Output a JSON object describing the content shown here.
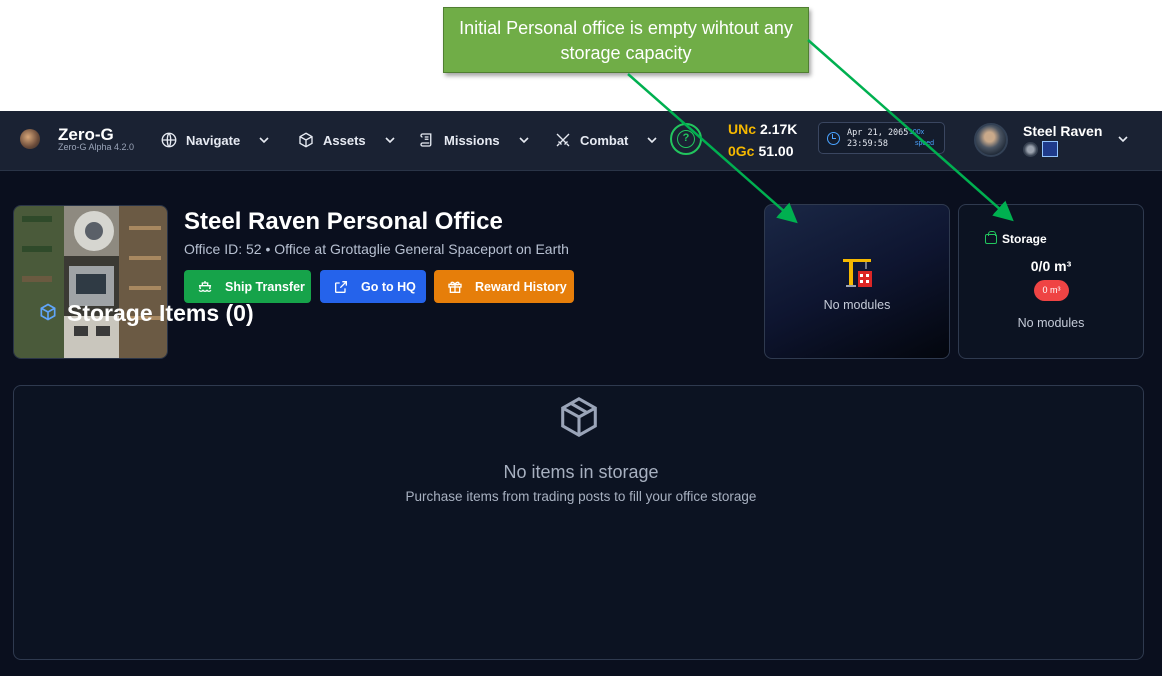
{
  "annotation": {
    "text": "Initial Personal office is empty wihtout any storage capacity",
    "color": "#70ad47",
    "arrow_color": "#00b050"
  },
  "brand": {
    "name": "Zero-G",
    "version": "Zero-G Alpha 4.2.0",
    "logo_icon": "planet-logo-icon"
  },
  "nav": {
    "items": [
      {
        "label": "Navigate",
        "icon": "globe-icon"
      },
      {
        "label": "Assets",
        "icon": "cube-icon"
      },
      {
        "label": "Missions",
        "icon": "scroll-icon"
      },
      {
        "label": "Combat",
        "icon": "crossed-swords-icon"
      }
    ],
    "help_icon": "question-circle-icon"
  },
  "currency": {
    "unc_code": "UNc",
    "unc_amount": "2.17K",
    "gc_code": "0Gc",
    "gc_amount": "51.00"
  },
  "clock": {
    "date": "Apr 21, 2065",
    "time": "23:59:58",
    "speed_value": "100x",
    "speed_label": "speed"
  },
  "user": {
    "name": "Steel Raven",
    "badges": [
      "rank-badge-icon",
      "emblem-badge-icon"
    ]
  },
  "office": {
    "title": "Steel Raven Personal Office",
    "subtitle": "Office ID: 52 • Office at Grottaglie General Spaceport on Earth",
    "buttons": {
      "ship_transfer": "Ship Transfer",
      "go_to_hq": "Go to HQ",
      "reward_history": "Reward History"
    }
  },
  "modules_card": {
    "icon": "construction-crane-icon",
    "text": "No modules"
  },
  "storage_card": {
    "heading": "Storage",
    "capacity": "0/0 m³",
    "pill": "0 m³",
    "text": "No modules"
  },
  "storage_items": {
    "title": "Storage Items (0)",
    "empty_title": "No items in storage",
    "empty_subtitle": "Purchase items from trading posts to fill your office storage"
  },
  "colors": {
    "app_bg": "#0a0f1e",
    "navbar_bg": "#1a2233",
    "green_button": "#16a34a",
    "blue_button": "#2563eb",
    "orange_button": "#e67e0a",
    "gold": "#f5b800",
    "pill_red": "#ef4444"
  }
}
